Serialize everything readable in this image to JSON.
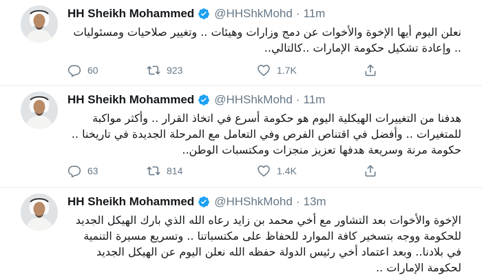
{
  "tweets": [
    {
      "name": "HH Sheikh Mohammed",
      "handle": "@HHShkMohd",
      "separator": "·",
      "time": "11m",
      "text": "نعلن اليوم أيها الإخوة والأخوات عن دمج وزارات وهيئات .. وتغيير صلاحيات ومسئوليات .. وإعادة تشكيل حكومة الإمارات ..كالتالي..",
      "replies": "60",
      "retweets": "923",
      "likes": "1.7K"
    },
    {
      "name": "HH Sheikh Mohammed",
      "handle": "@HHShkMohd",
      "separator": "·",
      "time": "11m",
      "text": "هدفنا من التغييرات الهيكلية اليوم هو حكومة أسرع في اتخاذ القرار .. وأكثر مواكبة للمتغيرات .. وأفضل في اقتناص الفرص وفي التعامل مع المرحلة الجديدة في تاريخنا .. حكومة مرنة وسريعة هدفها تعزيز منجزات ومكتسبات الوطن..",
      "replies": "63",
      "retweets": "814",
      "likes": "1.4K"
    },
    {
      "name": "HH Sheikh Mohammed",
      "handle": "@HHShkMohd",
      "separator": "·",
      "time": "13m",
      "text": "الإخوة والأخوات بعد التشاور مع أخي محمد بن زايد رعاه الله الذي بارك الهيكل الجديد للحكومة ووجه بتسخير كافة الموارد للحفاظ على مكتسباتنا .. وتسريع مسيرة التنمية في بلادنا.. وبعد اعتماد أخي رئيس الدولة حفظه الله نعلن اليوم عن الهيكل الجديد لحكومة الإمارات .."
    }
  ],
  "icons": {
    "avatar": "avatar-photo",
    "verified": "verified-badge-icon",
    "reply": "reply-icon",
    "retweet": "retweet-icon",
    "like": "heart-icon",
    "share": "share-icon"
  },
  "colors": {
    "verified": "#1da1f2",
    "muted": "#657786",
    "text": "#14171a",
    "divider": "#e6ecf0"
  }
}
